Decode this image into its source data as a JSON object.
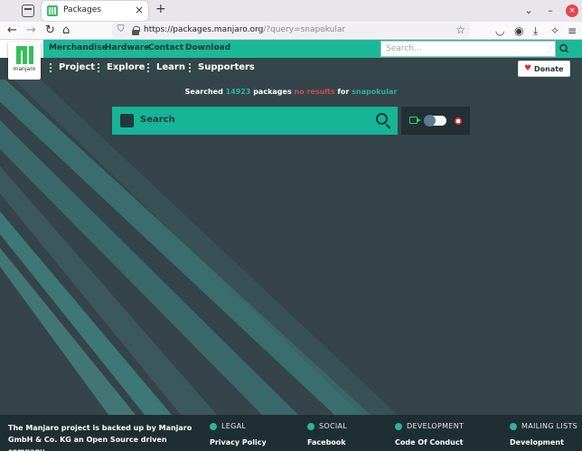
{
  "browser": {
    "tab_title": "Packages",
    "tab_close": "×",
    "new_tab": "+",
    "url_host": "https://packages.manjaro.org",
    "url_path": "/?query=snapokular",
    "win_minimize": "⌄",
    "win_restore": "–",
    "win_close": "×"
  },
  "site": {
    "top_links": [
      "Merchandise",
      "Hardware",
      "Contact",
      "Download"
    ],
    "search_placeholder": "Search...",
    "logo_text": "manjaro",
    "main_links": [
      "Project",
      "Explore",
      "Learn",
      "Supporters"
    ],
    "donate_label": "Donate"
  },
  "results": {
    "prefix": "Searched ",
    "count": "14923",
    "middle": " packages ",
    "no_results": "no results",
    "for_word": " for ",
    "query": "snapokular"
  },
  "search": {
    "label": "Search"
  },
  "footer": {
    "text": "The Manjaro project is backed up by Manjaro GmbH & Co. KG an Open Source driven company.",
    "columns": [
      {
        "heading": "LEGAL",
        "link": "Privacy Policy"
      },
      {
        "heading": "SOCIAL",
        "link": "Facebook"
      },
      {
        "heading": "DEVELOPMENT",
        "link": "Code Of Conduct"
      },
      {
        "heading": "MAILING LISTS",
        "link": "Development"
      }
    ]
  },
  "colors": {
    "brand_green": "#1bb998",
    "accent_teal": "#2cb2a0",
    "no_results_red": "#c55050",
    "page_bg": "#35434a"
  }
}
